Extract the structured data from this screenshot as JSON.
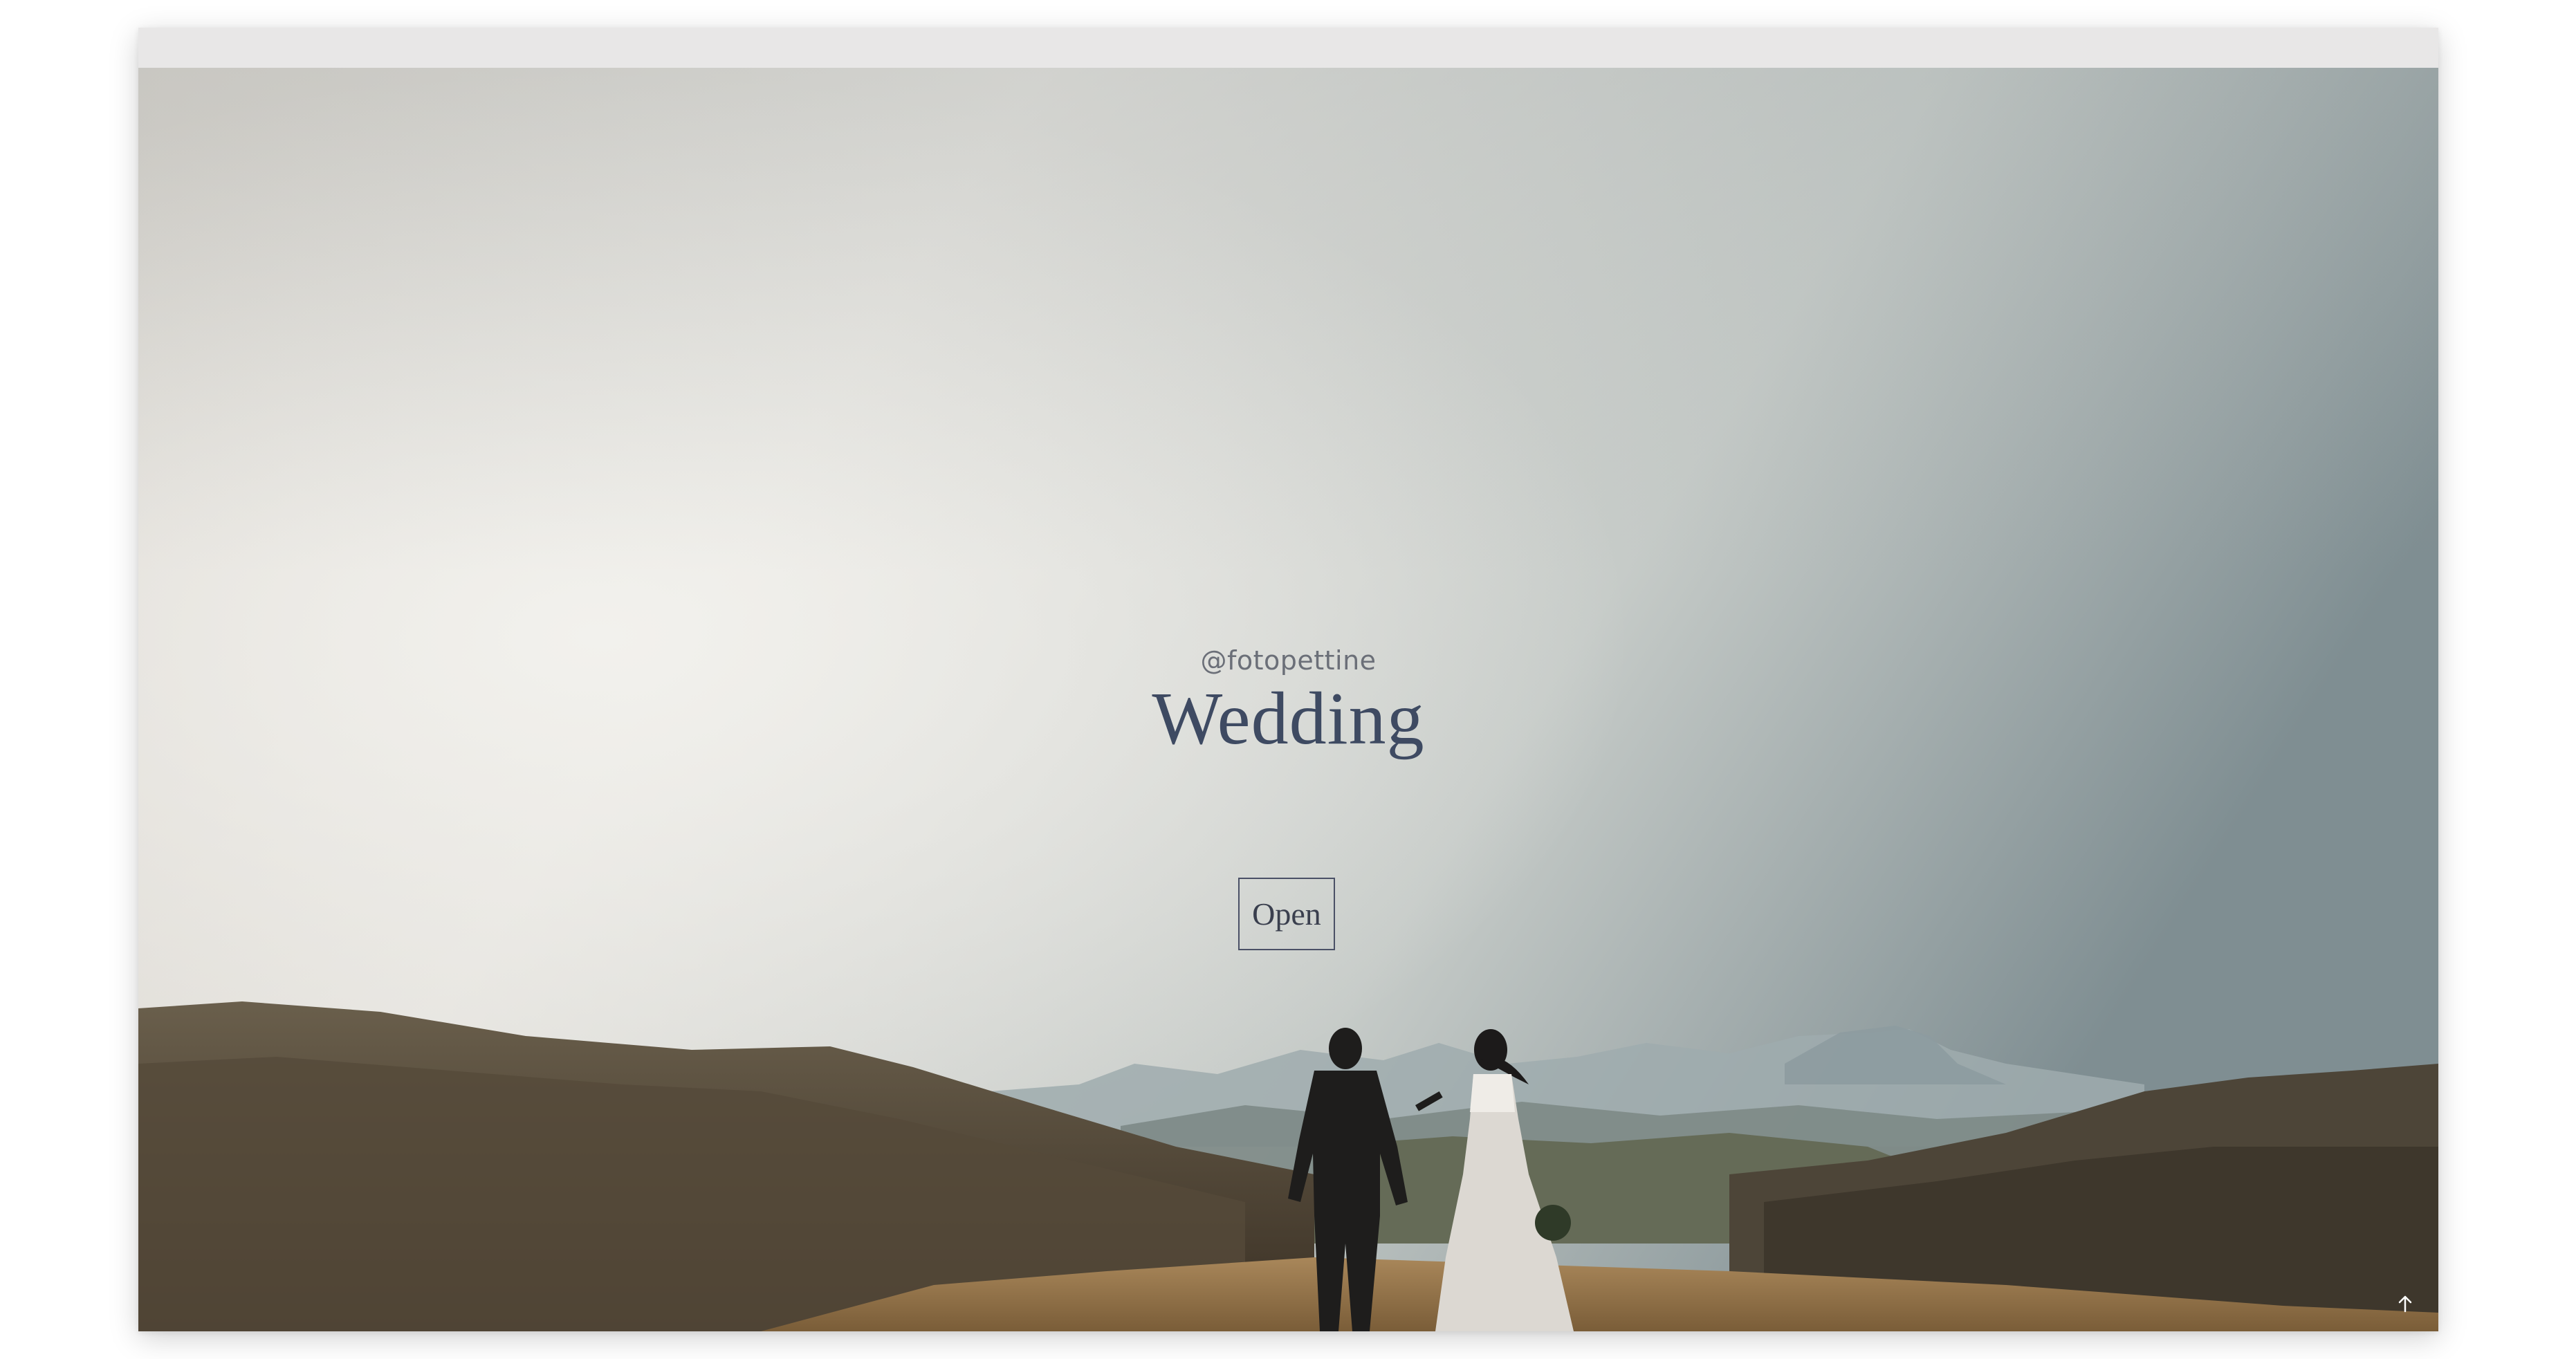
{
  "hero": {
    "handle": "@fotopettine",
    "title": "Wedding",
    "open_label": "Open",
    "scroll_top_icon": "arrow-up-icon"
  },
  "colors": {
    "title": "#3e4a62",
    "handle": "#6b6f78",
    "button_border": "#4a5066",
    "browser_bar": "#e8e7e7"
  }
}
